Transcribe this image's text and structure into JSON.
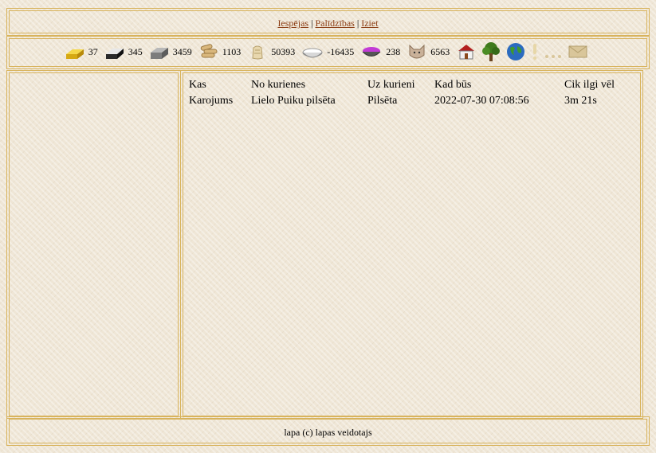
{
  "nav": {
    "links": [
      "Iespējas",
      "Palīdzības",
      "Iziet"
    ],
    "separator": " | "
  },
  "resources": [
    {
      "icon": "gold-bar-icon",
      "value": "37"
    },
    {
      "icon": "iron-bar-icon",
      "value": "345"
    },
    {
      "icon": "stone-block-icon",
      "value": "3459"
    },
    {
      "icon": "wood-logs-icon",
      "value": "1103"
    },
    {
      "icon": "grain-sack-icon",
      "value": "50393"
    },
    {
      "icon": "food-bowl-icon",
      "value": "-16435"
    },
    {
      "icon": "potion-bowl-icon",
      "value": "238"
    },
    {
      "icon": "population-cat-icon",
      "value": "6563"
    }
  ],
  "toolbar_icons": [
    "house-icon",
    "tree-icon",
    "globe-icon",
    "exclamation-icon",
    "ellipsis-icon",
    "envelope-icon"
  ],
  "table": {
    "headers": [
      "Kas",
      "No kurienes",
      "Uz kurieni",
      "Kad būs",
      "Cik ilgi vēl"
    ],
    "rows": [
      [
        "Karojums",
        "Lielo Puiku pilsēta",
        "Pilsēta",
        "2022-07-30 07:08:56",
        "3m 21s"
      ]
    ]
  },
  "footer": {
    "text": "lapa (c) lapas veidotajs"
  },
  "colors": {
    "border": "#d8b35c",
    "link": "#8a3b12",
    "background": "#efe6d6"
  }
}
